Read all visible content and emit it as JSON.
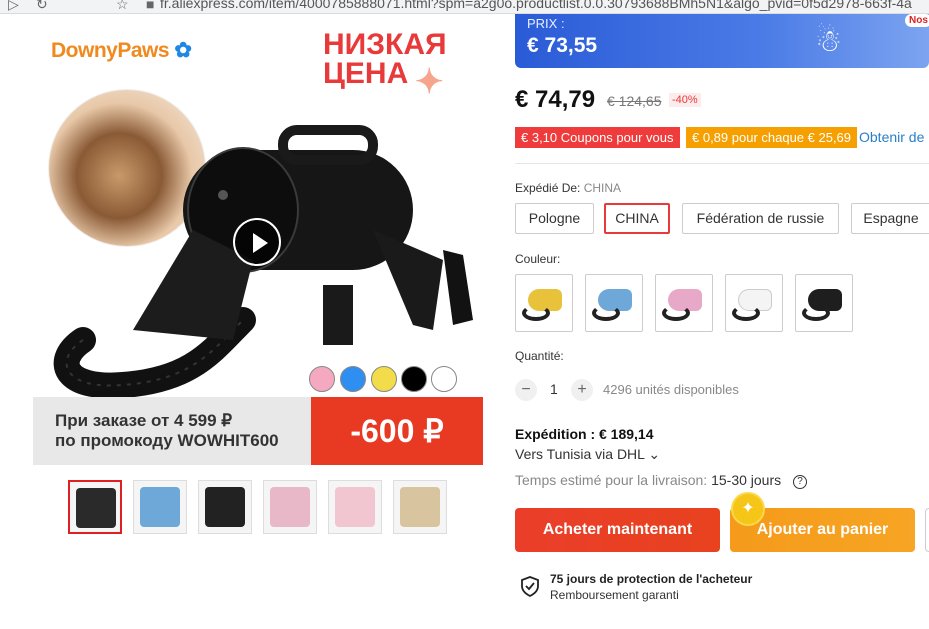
{
  "browser": {
    "url": "fr.aliexpress.com/item/4000785888071.html?spm=a2g0o.productlist.0.0.30793688BMh5N1&algo_pvid=0f5d2978-663f-4a"
  },
  "gallery": {
    "brand_logo": "DownyPaws",
    "promo_ru": [
      "НИЗКАЯ",
      "ЦЕНА"
    ],
    "banner_text": [
      "При заказе от 4 599 ₽",
      "по промокоду WOWHIT600"
    ],
    "banner_discount": "-600 ₽",
    "color_dots": [
      "#f4a9c0",
      "#2f8ff0",
      "#f2dc4a",
      "#000000",
      "#ffffff"
    ],
    "thumbnails": [
      {
        "color": "#2a2a2a"
      },
      {
        "color": "#6ea8d8"
      },
      {
        "color": "#222222"
      },
      {
        "color": "#e8b8c8"
      },
      {
        "color": "#f2c6d0"
      },
      {
        "color": "#d9c4a0"
      }
    ]
  },
  "promo_banner": {
    "label": "PRIX :",
    "price": "€ 73,55",
    "corner": "Nos"
  },
  "pricing": {
    "price": "€ 74,79",
    "old_price": "€ 124,65",
    "discount": "-40%",
    "coupons": [
      "€ 3,10 Coupons pour vous",
      "€ 0,89 pour chaque € 25,69"
    ],
    "coupons_link": "Obtenir de"
  },
  "shipping_from": {
    "label": "Expédié De:",
    "value": "CHINA",
    "options": [
      "Pologne",
      "CHINA",
      "Fédération de russie",
      "Espagne"
    ],
    "selected": "CHINA"
  },
  "color": {
    "label": "Couleur:",
    "swatches": [
      {
        "color": "#e8c23a"
      },
      {
        "color": "#6ea8d8"
      },
      {
        "color": "#e8a8c8"
      },
      {
        "color": "#f4f4f4"
      },
      {
        "color": "#1e1e1e"
      }
    ]
  },
  "quantity": {
    "label": "Quantité:",
    "minus": "−",
    "value": "1",
    "plus": "+",
    "available": "4296 unités disponibles"
  },
  "shipping": {
    "title": "Expédition : € 189,14",
    "via": "Vers Tunisia via DHL ⌄",
    "estimate_label": "Temps estimé pour la livraison:",
    "estimate_value": "15-30 jours",
    "help_icon": "?"
  },
  "actions": {
    "buy_now": "Acheter maintenant",
    "add_to_cart": "Ajouter au panier"
  },
  "guarantee": {
    "title": "75 jours de protection de l'acheteur",
    "subtitle": "Remboursement garanti"
  }
}
